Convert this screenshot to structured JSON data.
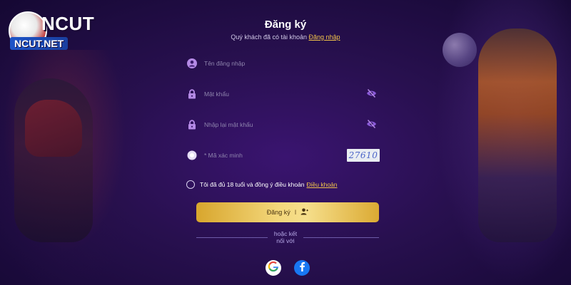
{
  "brand": {
    "logo_top": "NCUT",
    "logo_bottom": "NCUT.NET"
  },
  "form": {
    "title": "Đăng ký",
    "subtitle_prefix": "Quý khách đã có tài khoản",
    "login_link": "Đăng nhập",
    "fields": {
      "username_placeholder": "Tên đăng nhập",
      "password_placeholder": "Mật khẩu",
      "confirm_password_placeholder": "Nhập lại mật khẩu",
      "captcha_placeholder": "* Mã xác minh",
      "captcha_code": "27610"
    },
    "terms_text": "Tôi đã đủ 18 tuổi và đồng ý điều khoản",
    "terms_link": "Điều khoản",
    "submit_label": "Đăng ký",
    "submit_separator": "I",
    "divider_line1": "hoặc kết",
    "divider_line2": "nối với"
  },
  "social": {
    "google_icon": "google-icon",
    "facebook_icon": "facebook-icon"
  },
  "colors": {
    "accent_gold": "#f1c24a",
    "icon_purple": "#b58ae6",
    "background": "#28104f"
  }
}
